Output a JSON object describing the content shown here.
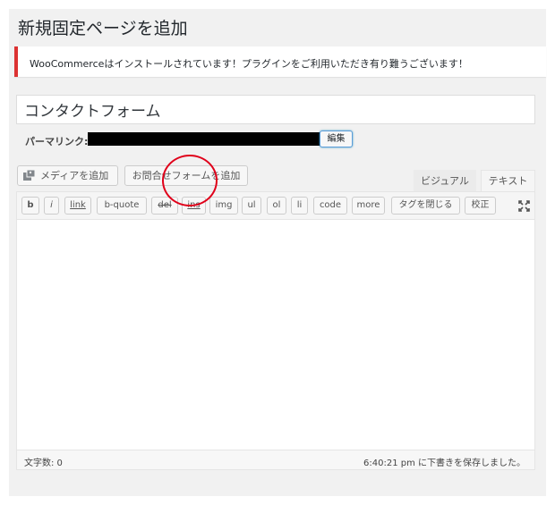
{
  "page": {
    "title": "新規固定ページを追加"
  },
  "notice": {
    "text": "WooCommerceはインストールされています！プラグインをご利用いただき有り難うございます！",
    "border_color": "#dc3232"
  },
  "post_title": {
    "value": "コンタクトフォーム"
  },
  "permalink": {
    "label": "パーマリンク:",
    "edit_label": "編集"
  },
  "media": {
    "add_media_label": "メディアを追加",
    "add_form_label": "お問合せフォームを追加",
    "icon": "media-icon"
  },
  "tabs": {
    "visual": "ビジュアル",
    "text": "テキスト"
  },
  "quicktags": [
    "b",
    "i",
    "link",
    "b-quote",
    "del",
    "ins",
    "img",
    "ul",
    "ol",
    "li",
    "code",
    "more",
    "タグを閉じる",
    "校正"
  ],
  "status": {
    "word_count": "文字数: 0",
    "autosave": "6:40:21 pm に下書きを保存しました。"
  },
  "annotation": {
    "color": "#e0001a"
  }
}
